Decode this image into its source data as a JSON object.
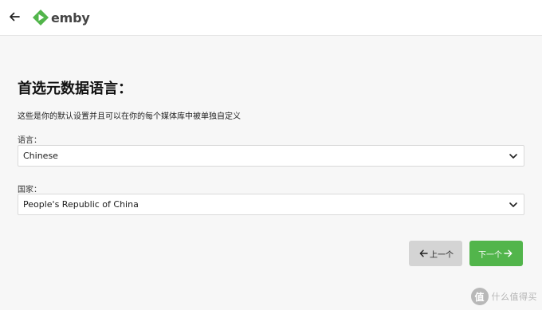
{
  "app": {
    "name": "emby",
    "brand_color": "#52b54b"
  },
  "header": {
    "back_icon": "arrow-left-icon",
    "logo_icon": "emby-play-logo-icon"
  },
  "main": {
    "title": "首选元数据语言：",
    "description": "这些是你的默认设置并且可以在你的每个媒体库中被单独自定义",
    "language": {
      "label": "语言：",
      "value": "Chinese"
    },
    "country": {
      "label": "国家：",
      "value": "People's Republic of China"
    }
  },
  "footer": {
    "prev_label": "上一个",
    "next_label": "下一个"
  },
  "watermark": {
    "badge": "值",
    "text": "什么值得买"
  }
}
